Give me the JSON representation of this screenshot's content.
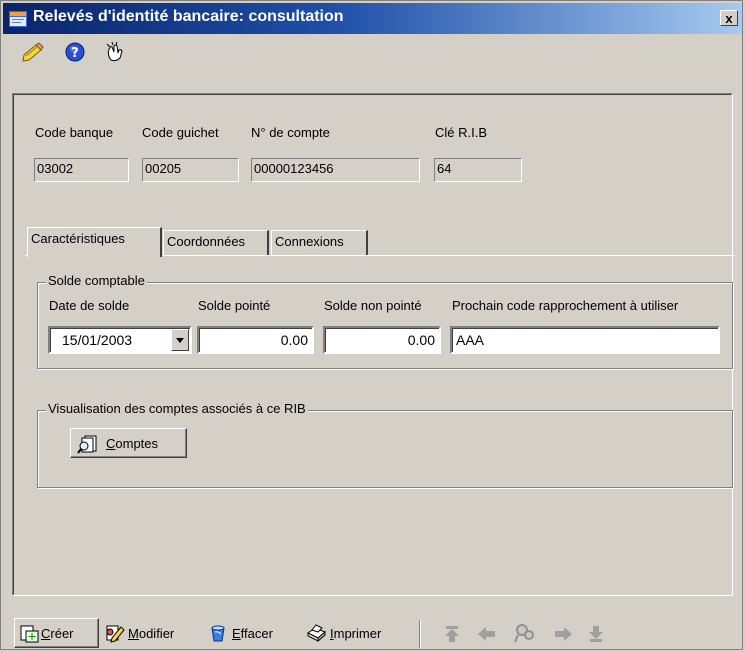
{
  "window": {
    "title": "Relevés d'identité bancaire: consultation",
    "close_glyph": "x"
  },
  "top_icons": [
    "edit-pencil-icon",
    "help-icon",
    "pointer-icon"
  ],
  "rib": {
    "code_banque": {
      "label": "Code banque",
      "value": "03002"
    },
    "code_guichet": {
      "label": "Code guichet",
      "value": "00205"
    },
    "numero_compte": {
      "label": "N° de compte",
      "value": "00000123456"
    },
    "cle_rib": {
      "label": "Clé R.I.B",
      "value": "64"
    }
  },
  "tabs": [
    {
      "label": "Caractéristiques",
      "active": true
    },
    {
      "label": "Coordonnées",
      "active": false
    },
    {
      "label": "Connexions",
      "active": false
    }
  ],
  "solde_comptable": {
    "legend": "Solde comptable",
    "date_label": "Date de solde",
    "date_value": "15/01/2003",
    "pointe_label": "Solde pointé",
    "pointe_value": "0.00",
    "non_pointe_label": "Solde non pointé",
    "non_pointe_value": "0.00",
    "code_label": "Prochain code rapprochement à utiliser",
    "code_value": "AAA"
  },
  "visualisation": {
    "legend": "Visualisation des comptes associés à ce RIB",
    "comptes_first": "C",
    "comptes_rest": "omptes"
  },
  "toolbar": {
    "creer_first": "C",
    "creer_rest": "réer",
    "modifier_first": "M",
    "modifier_rest": "odifier",
    "effacer_first": "E",
    "effacer_rest": "ffacer",
    "imprimer_first": "I",
    "imprimer_rest": "mprimer"
  },
  "nav_icons": [
    "first-record-icon",
    "previous-record-icon",
    "search-record-icon",
    "next-record-icon",
    "last-record-icon"
  ]
}
